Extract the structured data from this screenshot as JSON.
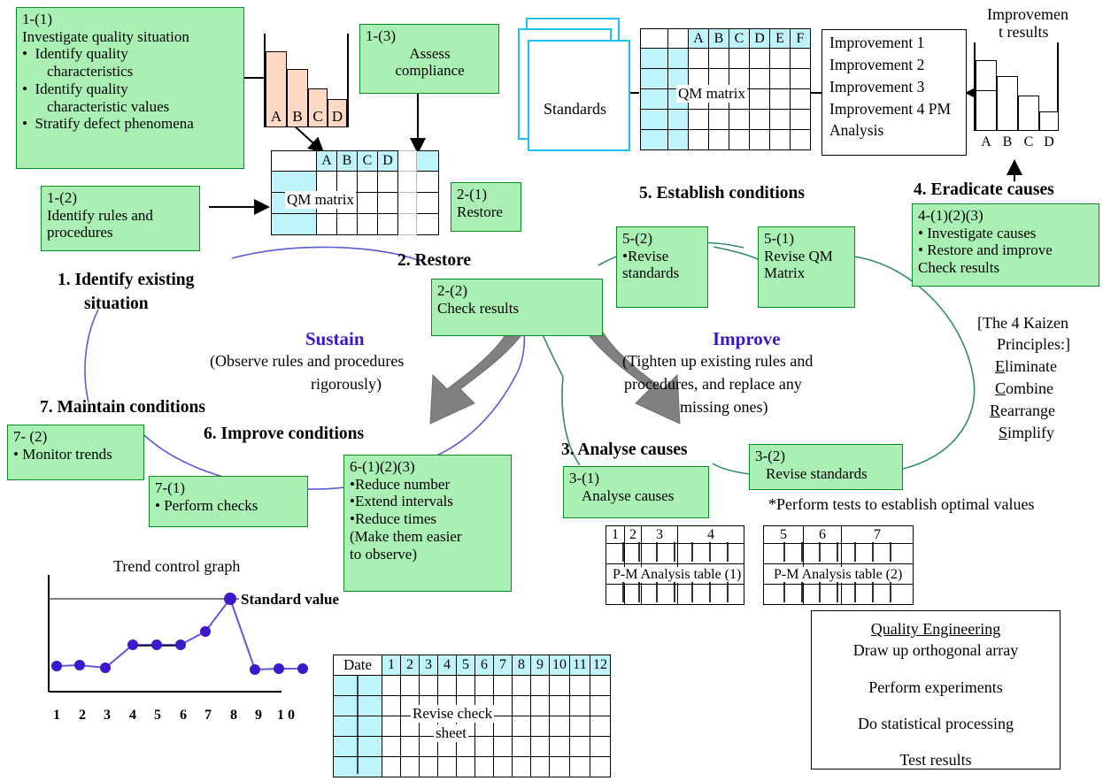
{
  "boxes": {
    "b1_1": {
      "num": "1-(1)",
      "title": "Investigate quality situation",
      "bullets": [
        "Identify quality",
        "characteristics",
        "Identify quality",
        "characteristic values",
        "Stratify defect phenomena"
      ]
    },
    "b1_2": {
      "l1": "1-(2)",
      "l2": "Identify rules and",
      "l3": "procedures"
    },
    "b1_3": {
      "l1": "1-(3)",
      "l2": "Assess",
      "l3": "compliance"
    },
    "b2_1": {
      "l1": "2-(1)",
      "l2": "Restore"
    },
    "b2_2": {
      "l1": "2-(2)",
      "l2": "Check results"
    },
    "b3_1": {
      "l1": "3-(1)",
      "l2": "Analyse causes"
    },
    "b3_2": {
      "l1": "3-(2)",
      "l2": "Revise standards"
    },
    "b4": {
      "l1": "4-(1)(2)(3)",
      "l2": "• Investigate causes",
      "l3": "• Restore and improve",
      "l4": "Check results"
    },
    "b5_1": {
      "l1": "5-(1)",
      "l2": "Revise QM",
      "l3": "Matrix"
    },
    "b5_2": {
      "l1": "5-(2)",
      "l2": "•Revise",
      "l3": "standards"
    },
    "b6": {
      "l1": "6-(1)(2)(3)",
      "l2": "•Reduce number",
      "l3": "•Extend intervals",
      "l4": "•Reduce times",
      "l5": "(Make them easier",
      "l6": "to observe)"
    },
    "b7_1": {
      "l1": "7-(1)",
      "l2": "• Perform checks"
    },
    "b7_2": {
      "l1": "7- (2)",
      "l2": "• Monitor trends"
    },
    "improvements": {
      "lines": [
        "Improvement 1",
        "Improvement 2",
        "Improvement 3",
        "Improvement 4",
        "PM Analysis"
      ]
    }
  },
  "stages": {
    "s1": "1. Identify existing",
    "s1b": "situation",
    "s2": "2. Restore",
    "s3": "3. Analyse causes",
    "s4": "4. Eradicate causes",
    "s5": "5. Establish conditions",
    "s6": "6. Improve conditions",
    "s7": "7. Maintain conditions"
  },
  "center": {
    "sustain_title": "Sustain",
    "sustain_l1": "(Observe rules and procedures",
    "sustain_l2": "rigorously)",
    "improve_title": "Improve",
    "improve_l1": "(Tighten up existing rules and",
    "improve_l2": "procedures, and replace any",
    "improve_l3": "missing ones)"
  },
  "kaizen": {
    "header_l1": "[The 4 Kaizen",
    "header_l2": "Principles:]",
    "items": [
      {
        "first": "E",
        "rest": "liminate"
      },
      {
        "first": "C",
        "rest": "ombine"
      },
      {
        "first": "R",
        "rest": "earrange"
      },
      {
        "first": "S",
        "rest": "implify"
      }
    ]
  },
  "notes": {
    "perform_tests": "*Perform tests to establish optimal values",
    "standards": "Standards",
    "improvement_results_l1": "Improvemen",
    "improvement_results_l2": "t results",
    "qm_matrix_left": "QM matrix",
    "qm_matrix_right": "QM matrix",
    "pm_table_1": "P-M Analysis table (1)",
    "pm_table_2": "P-M Analysis table (2)",
    "revise_check_l1": "Revise check",
    "revise_check_l2": "sheet",
    "date_header": "Date",
    "trend_title": "Trend control graph",
    "standard_value": "Standard value"
  },
  "quality_engineering": {
    "title": "Quality Engineering",
    "steps": [
      "Draw up orthogonal array",
      "Perform experiments",
      "Do statistical processing",
      "Test results"
    ]
  },
  "tables": {
    "qm_left_cols": [
      "A",
      "B",
      "C",
      "D"
    ],
    "qm_right_cols": [
      "A",
      "B",
      "C",
      "D",
      "E",
      "F"
    ],
    "pm1_headers": [
      "1",
      "2",
      "3",
      "4"
    ],
    "pm2_headers": [
      "5",
      "6",
      "7"
    ],
    "check_sheet_headers": [
      "1",
      "2",
      "3",
      "4",
      "5",
      "6",
      "7",
      "8",
      "9",
      "10",
      "11",
      "12"
    ]
  },
  "chart_data": [
    {
      "type": "bar",
      "title": "",
      "categories": [
        "A",
        "B",
        "C",
        "D"
      ],
      "values": [
        100,
        78,
        50,
        38
      ],
      "xlabel": "",
      "ylabel": "",
      "ylim": [
        0,
        110
      ],
      "grid": false,
      "legend": "none"
    },
    {
      "type": "bar",
      "title": "Improvement results",
      "categories": [
        "A",
        "B",
        "C",
        "D"
      ],
      "values": [
        100,
        76,
        50,
        28
      ],
      "xlabel": "",
      "ylabel": "",
      "ylim": [
        0,
        120
      ],
      "grid": false,
      "legend": "none"
    },
    {
      "type": "line",
      "title": "Trend control graph",
      "x": [
        1,
        2,
        3,
        4,
        5,
        6,
        7,
        8,
        9,
        10
      ],
      "xticklabels": [
        "1",
        "2",
        "3",
        "4",
        "5",
        "6",
        "7",
        "8",
        "9",
        "1 0"
      ],
      "values": [
        18,
        19,
        17,
        38,
        38,
        38,
        55,
        78,
        32,
        33,
        33
      ],
      "series": [
        {
          "name": "trend",
          "values": [
            18,
            19,
            17,
            38,
            38,
            38,
            55,
            78,
            32,
            33,
            33
          ]
        }
      ],
      "annotations": [
        {
          "text": "Standard value",
          "y": 78
        }
      ],
      "xlabel": "",
      "ylabel": "",
      "ylim": [
        0,
        100
      ],
      "grid": false,
      "legend": "right"
    }
  ],
  "colors": {
    "green_fill": "#aaf0b4",
    "green_border": "#0a8a22",
    "cyan_fill": "#bff4fa",
    "peach_fill": "#ffd9c4",
    "purple": "#3b18c9",
    "gray_arrow": "#808080",
    "blue_curve": "#5b5bd6",
    "teal_curve": "#2e8b72"
  }
}
